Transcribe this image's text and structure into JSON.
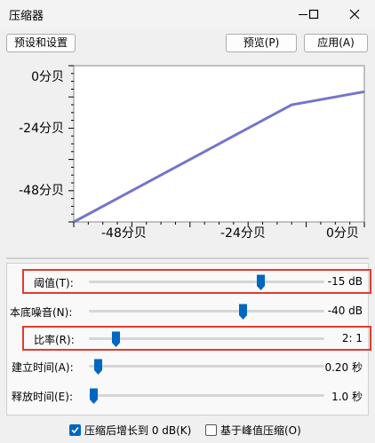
{
  "window": {
    "title": "压缩器",
    "icons": [
      "minimize-icon",
      "maximize-icon",
      "close-icon"
    ]
  },
  "toolbar": {
    "presets_label": "预设和设置",
    "preview_label": "预览(P)",
    "apply_label": "应用(A)"
  },
  "chart_data": {
    "type": "line",
    "y_tick_labels": [
      "0分贝",
      "-24分贝",
      "-48分贝"
    ],
    "x_tick_labels": [
      "-48分贝",
      "-24分贝",
      "0分贝"
    ],
    "xlim": [
      -60,
      0
    ],
    "ylim": [
      -60,
      0
    ],
    "grid": false,
    "series": [
      {
        "color": "#7575cb",
        "x": [
          -60,
          -15,
          0
        ],
        "y": [
          -60,
          -15,
          -10
        ]
      }
    ]
  },
  "controls": [
    {
      "label": "阈值(T):",
      "value": "-15 dB",
      "fraction": 0.74,
      "highlighted": true
    },
    {
      "label": "本底噪音(N):",
      "value": "-40 dB",
      "fraction": 0.66,
      "highlighted": false
    },
    {
      "label": "比率(R):",
      "value": "2: 1",
      "fraction": 0.1,
      "highlighted": true
    },
    {
      "label": "建立时间(A):",
      "value": "0.20 秒",
      "fraction": 0.02,
      "highlighted": false
    },
    {
      "label": "释放时间(E):",
      "value": "1.0 秒",
      "fraction": 0.0,
      "highlighted": false
    }
  ],
  "options": {
    "makeup_label": "压缩后增长到 0 dB(K)",
    "makeup_checked": true,
    "peak_label": "基于峰值压缩(O)",
    "peak_checked": false
  },
  "colors": {
    "thumb": "#0067c0",
    "curve": "#7575cb",
    "highlight": "#e23b2e"
  }
}
